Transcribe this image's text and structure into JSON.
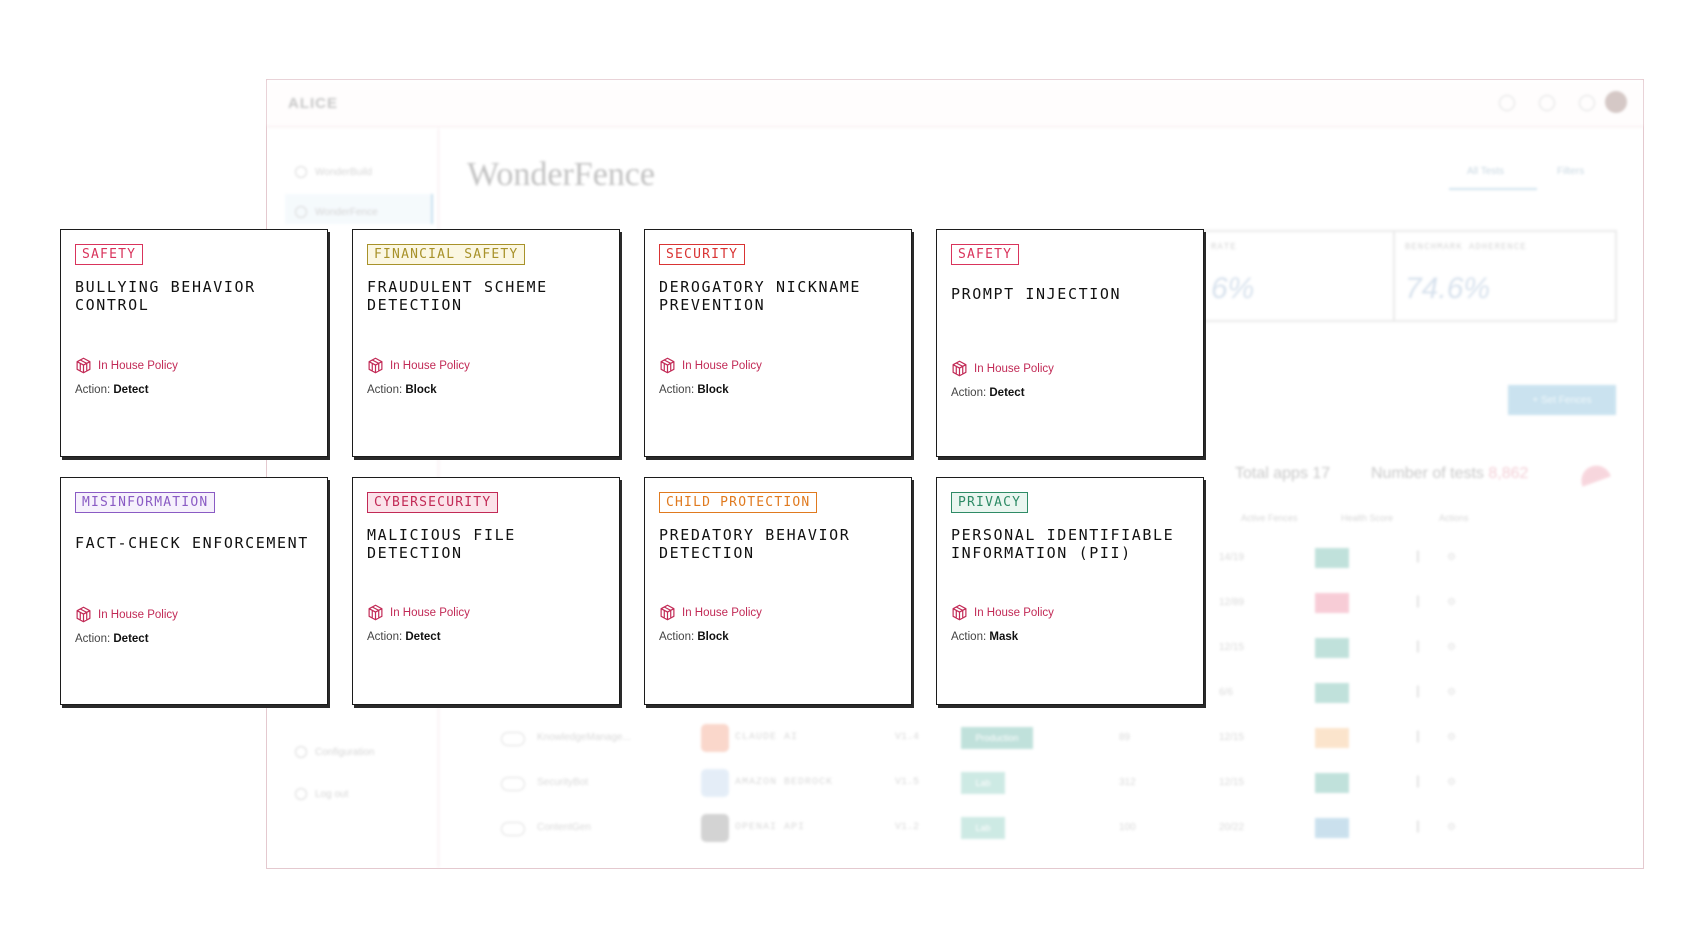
{
  "app": {
    "logo": "ALICE",
    "sidebar": {
      "items": [
        "WonderBuild",
        "WonderFence",
        "Configuration",
        "Log out"
      ]
    },
    "title": "WonderFence",
    "tabs": [
      "All Tests",
      "Filters"
    ],
    "stats": [
      {
        "label": "RATE",
        "value": "6%"
      },
      {
        "label": "BENCHMARK ADHERENCE",
        "value": "74.6%"
      }
    ],
    "add_button": "+ Set Fences",
    "totals": {
      "apps_label": "Total apps",
      "apps_value": "17",
      "tests_label": "Number of tests",
      "tests_value": "8,862"
    },
    "columns": [
      "Active Fences",
      "Health Score",
      "Actions"
    ],
    "rows": [
      {
        "name": "",
        "model": "",
        "version": "",
        "env": "",
        "count": "",
        "fences": "14/19",
        "health_color": "#8ec9bf"
      },
      {
        "name": "",
        "model": "",
        "version": "",
        "env": "",
        "count": "",
        "fences": "12/89",
        "health_color": "#f2a3b6"
      },
      {
        "name": "",
        "model": "",
        "version": "",
        "env": "",
        "count": "",
        "fences": "12/15",
        "health_color": "#8ec9bf"
      },
      {
        "name": "",
        "model": "",
        "version": "",
        "env": "",
        "count": "",
        "fences": "6/6",
        "health_color": "#8ec9bf"
      },
      {
        "name": "KnowledgeManage...",
        "model": "CLAUDE AI",
        "version": "V1.4",
        "env": "Production",
        "count": "89",
        "fences": "12/15",
        "health_color": "#f8cfa4"
      },
      {
        "name": "SecurityBot",
        "model": "AMAZON BEDROCK",
        "version": "V1.5",
        "env": "Lab",
        "count": "312",
        "fences": "12/15",
        "health_color": "#8ec9bf"
      },
      {
        "name": "ContentGen",
        "model": "OPENAI API",
        "version": "V1.2",
        "env": "Lab",
        "count": "100",
        "fences": "20/22",
        "health_color": "#9fc8e0"
      }
    ]
  },
  "cards": [
    {
      "tag": "SAFETY",
      "tag_color": "#d9345c",
      "tag_bg": "#ffffff",
      "title": "BULLYING BEHAVIOR\nCONTROL",
      "policy": "In House Policy",
      "action_label": "Action:",
      "action": "Detect"
    },
    {
      "tag": "FINANCIAL SAFETY",
      "tag_color": "#a8922a",
      "tag_bg": "#fbf7e2",
      "title": "FRAUDULENT SCHEME\nDETECTION",
      "policy": "In House Policy",
      "action_label": "Action:",
      "action": "Block"
    },
    {
      "tag": "SECURITY",
      "tag_color": "#d93434",
      "tag_bg": "#ffffff",
      "title": "DEROGATORY NICKNAME\nPREVENTION",
      "policy": "In House Policy",
      "action_label": "Action:",
      "action": "Block"
    },
    {
      "tag": "SAFETY",
      "tag_color": "#d9345c",
      "tag_bg": "#ffffff",
      "title": "PROMPT INJECTION",
      "policy": "In House Policy",
      "action_label": "Action:",
      "action": "Detect"
    },
    {
      "tag": "MISINFORMATION",
      "tag_color": "#8a5bc4",
      "tag_bg": "#f6f1fc",
      "title": "FACT-CHECK ENFORCEMENT",
      "policy": "In House Policy",
      "action_label": "Action:",
      "action": "Detect"
    },
    {
      "tag": "CYBERSECURITY",
      "tag_color": "#c22a56",
      "tag_bg": "#fbe3ea",
      "title": "MALICIOUS FILE\nDETECTION",
      "policy": "In House Policy",
      "action_label": "Action:",
      "action": "Detect"
    },
    {
      "tag": "CHILD PROTECTION",
      "tag_color": "#e07a1f",
      "tag_bg": "#ffffff",
      "title": "PREDATORY BEHAVIOR\nDETECTION",
      "policy": "In House Policy",
      "action_label": "Action:",
      "action": "Block"
    },
    {
      "tag": "PRIVACY",
      "tag_color": "#2e8b66",
      "tag_bg": "#eaf6f0",
      "title": "PERSONAL IDENTIFIABLE\nINFORMATION (PII)",
      "policy": "In House Policy",
      "action_label": "Action:",
      "action": "Mask"
    }
  ]
}
